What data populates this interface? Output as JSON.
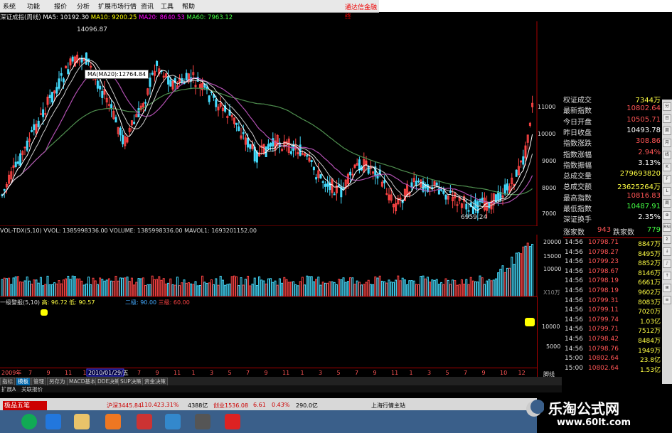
{
  "menu": [
    "系统",
    "功能",
    "报价",
    "分析",
    "扩展市场行情",
    "资讯",
    "工具",
    "帮助"
  ],
  "menu_right": "通达信金融终",
  "main_chart": {
    "title": "深证成指(周线)",
    "ma5": "MA5: 10192.30",
    "ma10": "MA10: 9200.25",
    "ma20": "MA20: 8640.53",
    "ma60": "MA60: 7963.12",
    "high_label": "14096.87",
    "low_label": "6959.24",
    "tooltip": "MA(MA20):12764.84",
    "right_axis": [
      "11000",
      "10000",
      "9000",
      "8000",
      "7000"
    ]
  },
  "volume_panel": {
    "header": "VOL-TDX(5,10)  VVOL: 1385998336.00  VOLUME: 1385998336.00  MAVOL1: 1693201152.00",
    "axis": [
      "20000",
      "15000",
      "10000"
    ],
    "unit": "X10万"
  },
  "signal_panel": {
    "header": "一级警报(5,10)",
    "high": "高: 96.72",
    "low": "低: 90.57",
    "level2": "二级: 90.00",
    "level3": "三级: 60.00",
    "axis": [
      "10000",
      "5000"
    ]
  },
  "time_axis": {
    "start": "2009年",
    "cursor_date": "2010/01/29/五",
    "months": [
      "7",
      "9",
      "11",
      "1",
      "3",
      "5",
      "7",
      "9",
      "11",
      "1",
      "3",
      "5",
      "7",
      "9",
      "11",
      "1",
      "3",
      "5",
      "7",
      "9",
      "11",
      "1",
      "3",
      "5",
      "7",
      "9",
      "10",
      "12"
    ]
  },
  "bottom_tabs": [
    "指标",
    "模板",
    "管理",
    "另存为",
    "MACD基本",
    "DDE决策",
    "SUP决策",
    "资金决策"
  ],
  "bottom_tabs2": [
    "扩展A",
    "关联报价"
  ],
  "quote": {
    "rows": [
      {
        "label": "权证成交",
        "value": "7344万",
        "color": "#ff4"
      },
      {
        "label": "最新指数",
        "value": "10802.64",
        "color": "#f55"
      },
      {
        "label": "今日开盘",
        "value": "10505.71",
        "color": "#f55"
      },
      {
        "label": "昨日收盘",
        "value": "10493.78",
        "color": "#fff"
      },
      {
        "label": "指数涨跌",
        "value": "308.86",
        "color": "#f55"
      },
      {
        "label": "指数涨幅",
        "value": "2.94%",
        "color": "#f55"
      },
      {
        "label": "指数振幅",
        "value": "3.13%",
        "color": "#fff"
      },
      {
        "label": "总成交量",
        "value": "279693820",
        "color": "#ff4"
      },
      {
        "label": "总成交额",
        "value": "23625264万",
        "color": "#ff4"
      },
      {
        "label": "最高指数",
        "value": "10816.83",
        "color": "#f55"
      },
      {
        "label": "最低指数",
        "value": "10487.91",
        "color": "#4f4"
      },
      {
        "label": "深证换手",
        "value": "2.35%",
        "color": "#fff"
      }
    ],
    "updown": {
      "up_label": "涨家数",
      "up": "943",
      "down_label": "跌家数",
      "down": "779"
    }
  },
  "ticks": [
    {
      "t": "14:56",
      "p": "10798.71",
      "v": "8847万"
    },
    {
      "t": "14:56",
      "p": "10798.27",
      "v": "8495万"
    },
    {
      "t": "14:56",
      "p": "10799.23",
      "v": "8852万"
    },
    {
      "t": "14:56",
      "p": "10798.67",
      "v": "8146万"
    },
    {
      "t": "14:56",
      "p": "10798.19",
      "v": "6661万"
    },
    {
      "t": "14:56",
      "p": "10798.19",
      "v": "9602万"
    },
    {
      "t": "14:56",
      "p": "10799.31",
      "v": "8083万"
    },
    {
      "t": "14:56",
      "p": "10799.11",
      "v": "7020万"
    },
    {
      "t": "14:56",
      "p": "10799.74",
      "v": "1.03亿"
    },
    {
      "t": "14:56",
      "p": "10799.71",
      "v": "7512万"
    },
    {
      "t": "14:56",
      "p": "10798.42",
      "v": "8484万"
    },
    {
      "t": "14:56",
      "p": "10798.76",
      "v": "1949万"
    },
    {
      "t": "15:00",
      "p": "10802.64",
      "v": "23.8亿"
    },
    {
      "t": "15:00",
      "p": "10802.64",
      "v": "1.53亿"
    }
  ],
  "ticks_footer": "脚线",
  "status": {
    "sh": "沪深3445.84",
    "sh_chg": "110.42",
    "sh_pct": "3.31%",
    "sh_vol": "4388亿",
    "cy": "创业1536.08",
    "cy_chg": "6.61",
    "cy_pct": "0.43%",
    "cy_vol": "290.0亿",
    "site": "上海行情主站"
  },
  "taskbar": {
    "start": "极品五笔"
  },
  "watermark": {
    "title": "乐淘公式网",
    "url": "www.60lt.com"
  },
  "side_toolbar": [
    "分",
    "日",
    "周",
    "月",
    "线",
    "K",
    "F",
    "L",
    "周",
    "⊕",
    "RSI",
    "Σ",
    "↓",
    "♪",
    "↑",
    "⊞",
    "≡"
  ]
}
